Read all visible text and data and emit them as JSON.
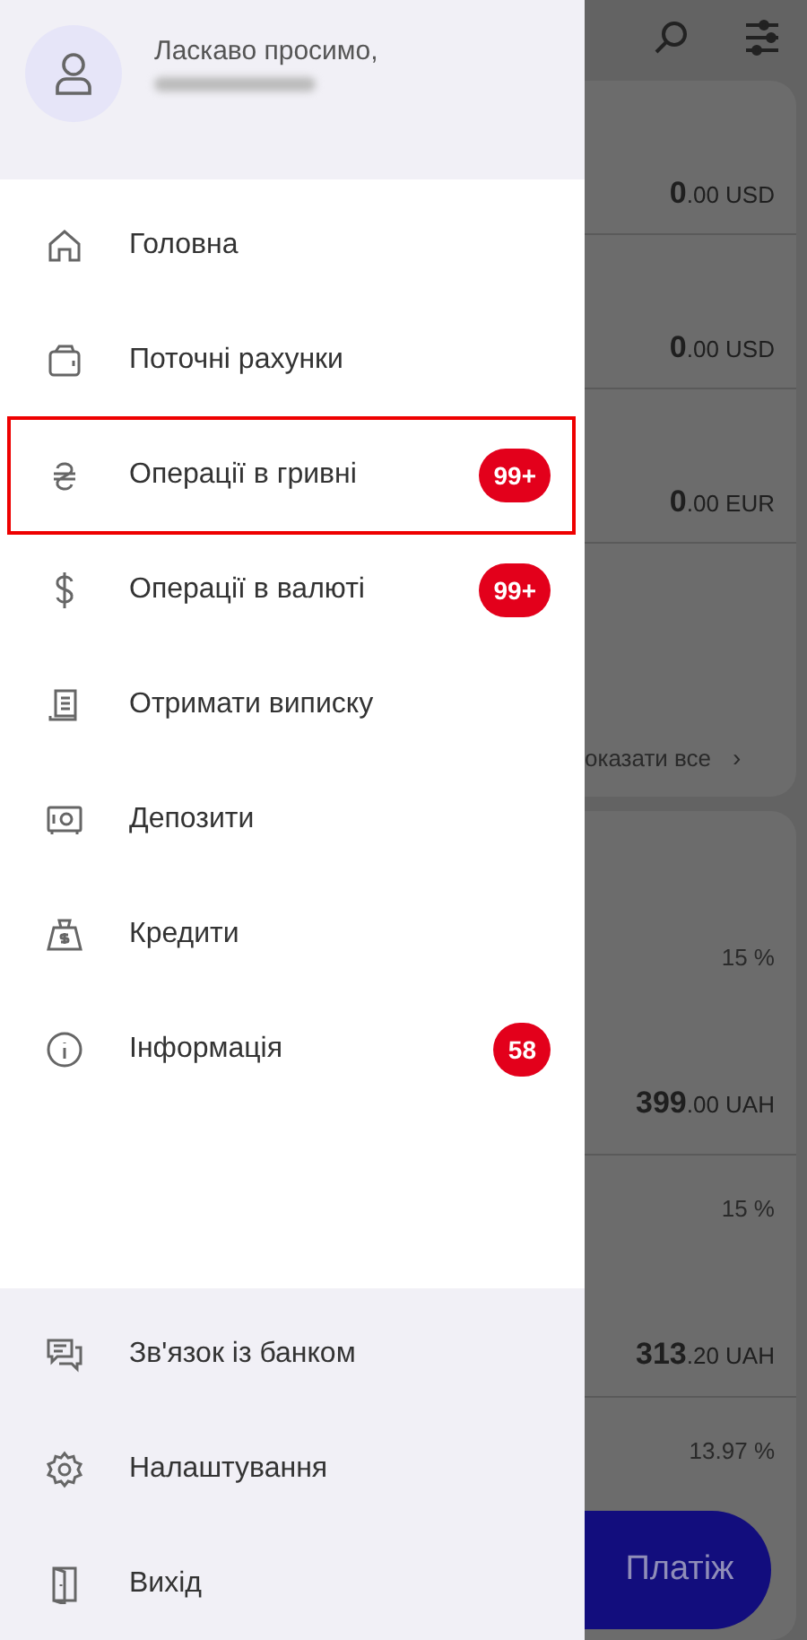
{
  "drawer": {
    "greeting": "Ласкаво просимо,",
    "menu": [
      {
        "label": "Головна",
        "highlighted": false
      },
      {
        "label": "Поточні рахунки",
        "highlighted": false
      },
      {
        "label": "Операції в гривні",
        "badge": "99+",
        "highlighted": true
      },
      {
        "label": "Операції в валюті",
        "badge": "99+",
        "highlighted": false
      },
      {
        "label": "Отримати виписку",
        "highlighted": false
      },
      {
        "label": "Депозити",
        "highlighted": false
      },
      {
        "label": "Кредити",
        "highlighted": false
      },
      {
        "label": "Інформація",
        "badge": "58",
        "highlighted": false
      }
    ],
    "footer": [
      {
        "label": "Зв'язок із банком"
      },
      {
        "label": "Налаштування"
      },
      {
        "label": "Вихід"
      }
    ]
  },
  "background": {
    "accounts": [
      {
        "int": "0",
        "frac": ".00",
        "currency": "USD"
      },
      {
        "int": "0",
        "frac": ".00",
        "currency": "USD"
      },
      {
        "int": "0",
        "frac": ".00",
        "currency": "EUR"
      }
    ],
    "show_all": "оказати все",
    "show_all_chevron": "›",
    "loans": [
      {
        "rate": "15 %",
        "int": "399",
        "frac": ".00",
        "currency": "UAH"
      },
      {
        "rate": "15 %",
        "int": "313",
        "frac": ".20",
        "currency": "UAH"
      },
      {
        "rate": "13.97 %"
      }
    ],
    "pay_button": "Платіж"
  }
}
